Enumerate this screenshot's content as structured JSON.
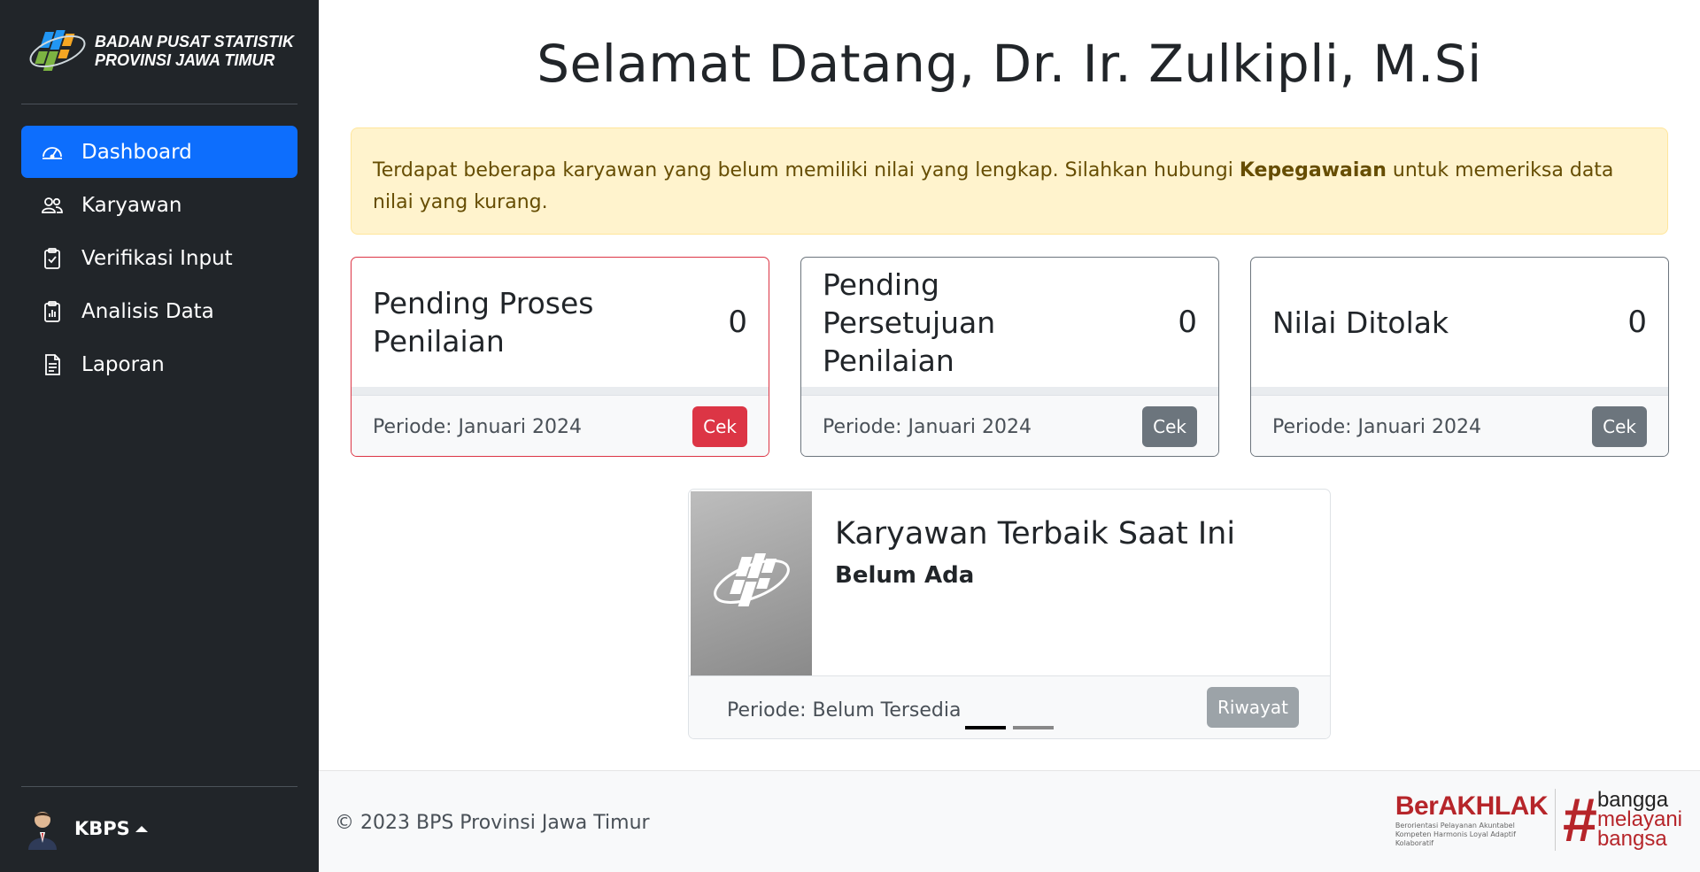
{
  "sidebar": {
    "brand_line1": "BADAN PUSAT STATISTIK",
    "brand_line2": "PROVINSI JAWA TIMUR",
    "items": [
      {
        "label": "Dashboard",
        "icon": "speedometer-icon",
        "active": true
      },
      {
        "label": "Karyawan",
        "icon": "people-icon",
        "active": false
      },
      {
        "label": "Verifikasi Input",
        "icon": "clipboard-check-icon",
        "active": false
      },
      {
        "label": "Analisis Data",
        "icon": "clipboard-data-icon",
        "active": false
      },
      {
        "label": "Laporan",
        "icon": "file-text-icon",
        "active": false
      }
    ],
    "user_name": "KBPS"
  },
  "main": {
    "title": "Selamat Datang, Dr. Ir. Zulkipli, M.Si",
    "alert": {
      "text_before": "Terdapat beberapa karyawan yang belum memiliki nilai yang lengkap. Silahkan hubungi ",
      "bold": "Kepegawaian",
      "text_after": " untuk memeriksa data nilai yang kurang."
    },
    "cards": [
      {
        "title": "Pending Proses Penilaian",
        "value": "0",
        "period": "Periode: Januari 2024",
        "button": "Cek",
        "variant": "danger"
      },
      {
        "title": "Pending Persetujuan Penilaian",
        "value": "0",
        "period": "Periode: Januari 2024",
        "button": "Cek",
        "variant": "secondary"
      },
      {
        "title": "Nilai Ditolak",
        "value": "0",
        "period": "Periode: Januari 2024",
        "button": "Cek",
        "variant": "secondary"
      }
    ],
    "best_employee": {
      "title": "Karyawan Terbaik Saat Ini",
      "name": "Belum Ada",
      "period": "Periode: Belum Tersedia",
      "button": "Riwayat",
      "carousel_slides": 2,
      "carousel_active": 1
    }
  },
  "footer": {
    "copyright": "© 2023 BPS Provinsi Jawa Timur",
    "berakhlak_word": "BerAKHLAK",
    "berakhlak_tagline": "Berorientasi Pelayanan Akuntabel Kompeten Harmonis Loyal Adaptif Kolaboratif",
    "bangga_line1": "bangga",
    "bangga_line2": "melayani",
    "bangga_line3": "bangsa"
  },
  "colors": {
    "sidebar_bg": "#212529",
    "primary": "#0d6efd",
    "danger": "#dc3545",
    "secondary": "#6c757d",
    "alert_bg": "#fff3cd",
    "alert_text": "#664d03"
  }
}
